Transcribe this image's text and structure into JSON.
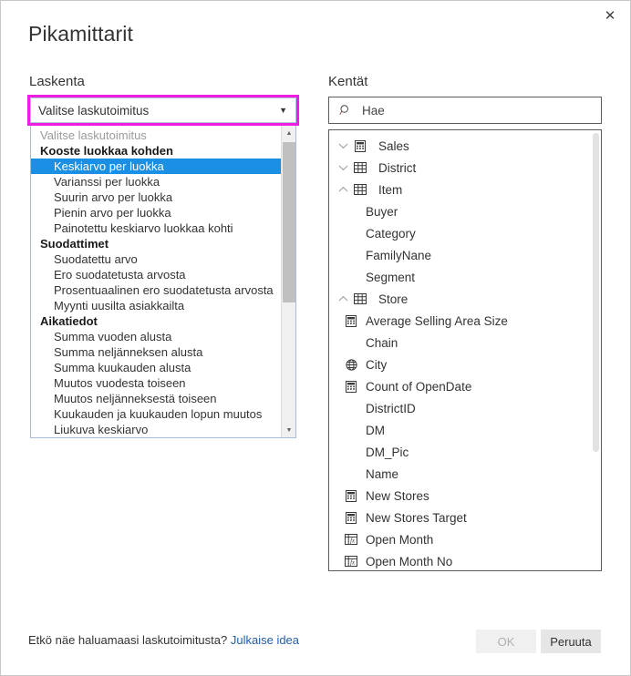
{
  "dialog": {
    "title": "Pikamittarit",
    "close_icon": "close-icon"
  },
  "calculation": {
    "label": "Laskenta",
    "combo": {
      "value": "Valitse laskutoimitus",
      "arrow_icon": "chevron-down-icon"
    },
    "dropdown": {
      "placeholder": "Valitse laskutoimitus",
      "selected": "Keskiarvo per luokka",
      "groups": [
        {
          "title": "Kooste luokkaa kohden",
          "options": [
            "Keskiarvo per luokka",
            "Varianssi per luokka",
            "Suurin arvo per luokka",
            "Pienin arvo per luokka",
            "Painotettu keskiarvo luokkaa kohti"
          ]
        },
        {
          "title": "Suodattimet",
          "options": [
            "Suodatettu arvo",
            "Ero suodatetusta arvosta",
            "Prosentuaalinen ero suodatetusta arvosta",
            "Myynti uusilta asiakkailta"
          ]
        },
        {
          "title": "Aikatiedot",
          "options": [
            "Summa vuoden alusta",
            "Summa neljänneksen alusta",
            "Summa kuukauden alusta",
            "Muutos vuodesta toiseen",
            "Muutos neljänneksestä toiseen",
            "Kuukauden ja kuukauden lopun muutos",
            "Liukuva keskiarvo"
          ]
        }
      ],
      "scrollbar": {
        "up_icon": "scroll-up-arrow-icon",
        "down_icon": "scroll-down-arrow-icon"
      }
    }
  },
  "fields": {
    "label": "Kentät",
    "search": {
      "placeholder": "Hae",
      "value": "",
      "icon": "search-icon"
    },
    "items": [
      {
        "label": "Sales",
        "kind": "table",
        "icon": "calculator-icon",
        "expander": "chevron-down-icon"
      },
      {
        "label": "District",
        "kind": "table",
        "icon": "table-grid-icon",
        "expander": "chevron-down-icon"
      },
      {
        "label": "Item",
        "kind": "table",
        "icon": "table-grid-icon",
        "expander": "chevron-up-icon"
      },
      {
        "label": "Buyer",
        "kind": "field",
        "icon": ""
      },
      {
        "label": "Category",
        "kind": "field",
        "icon": ""
      },
      {
        "label": "FamilyNane",
        "kind": "field",
        "icon": ""
      },
      {
        "label": "Segment",
        "kind": "field",
        "icon": ""
      },
      {
        "label": "Store",
        "kind": "table",
        "icon": "table-grid-icon",
        "expander": "chevron-up-icon"
      },
      {
        "label": "Average Selling Area Size",
        "kind": "field",
        "icon": "calculator-icon"
      },
      {
        "label": "Chain",
        "kind": "field",
        "icon": ""
      },
      {
        "label": "City",
        "kind": "field",
        "icon": "globe-icon"
      },
      {
        "label": "Count of OpenDate",
        "kind": "field",
        "icon": "calculator-icon"
      },
      {
        "label": "DistrictID",
        "kind": "field",
        "icon": ""
      },
      {
        "label": "DM",
        "kind": "field",
        "icon": ""
      },
      {
        "label": "DM_Pic",
        "kind": "field",
        "icon": ""
      },
      {
        "label": "Name",
        "kind": "field",
        "icon": ""
      },
      {
        "label": "New Stores",
        "kind": "field",
        "icon": "calculator-icon"
      },
      {
        "label": "New Stores Target",
        "kind": "field",
        "icon": "calculator-icon"
      },
      {
        "label": "Open Month",
        "kind": "field",
        "icon": "calculated-column-icon"
      },
      {
        "label": "Open Month No",
        "kind": "field",
        "icon": "calculated-column-icon"
      }
    ]
  },
  "footer": {
    "note_text": "Etkö näe haluamaasi laskutoimitusta?",
    "link_text": "Julkaise idea",
    "ok_label": "OK",
    "cancel_label": "Peruuta"
  },
  "colors": {
    "accent_highlight": "#1a8fe3",
    "callout_magenta": "#ee1ee0",
    "link": "#1f5fa9",
    "dialog_border": "#c8c8c8"
  }
}
